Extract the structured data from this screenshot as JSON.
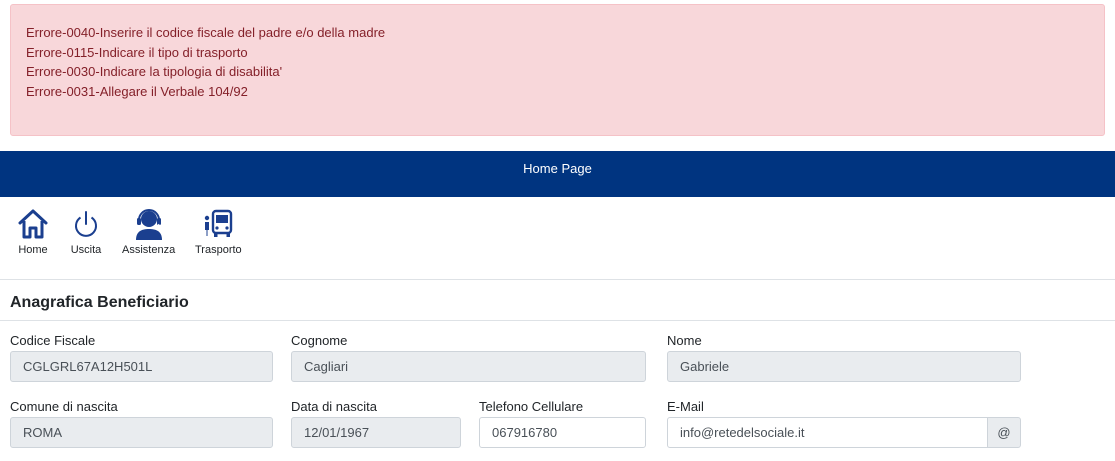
{
  "errors": [
    "Errore-0040-Inserire il codice fiscale del padre e/o della madre",
    "Errore-0115-Indicare il tipo di trasporto",
    "Errore-0030-Indicare la tipologia di disabilita'",
    "Errore-0031-Allegare il Verbale 104/92"
  ],
  "navbar": {
    "title": "Home Page",
    "background": "#003480"
  },
  "toolbar": {
    "home": {
      "label": "Home",
      "icon": "home-icon"
    },
    "exit": {
      "label": "Uscita",
      "icon": "power-icon"
    },
    "support": {
      "label": "Assistenza",
      "icon": "headset-user-icon"
    },
    "transport": {
      "label": "Trasporto",
      "icon": "bus-transport-icon"
    }
  },
  "section": {
    "title": "Anagrafica Beneficiario"
  },
  "form": {
    "codice_fiscale": {
      "label": "Codice Fiscale",
      "value": "CGLGRL67A12H501L"
    },
    "cognome": {
      "label": "Cognome",
      "value": "Cagliari"
    },
    "nome": {
      "label": "Nome",
      "value": "Gabriele"
    },
    "comune_nascita": {
      "label": "Comune di nascita",
      "value": "ROMA"
    },
    "data_nascita": {
      "label": "Data di nascita",
      "value": "12/01/1967"
    },
    "telefono": {
      "label": "Telefono Cellulare",
      "value": "067916780"
    },
    "email": {
      "label": "E-Mail",
      "value": "info@retedelsociale.it",
      "addon": "@"
    }
  }
}
